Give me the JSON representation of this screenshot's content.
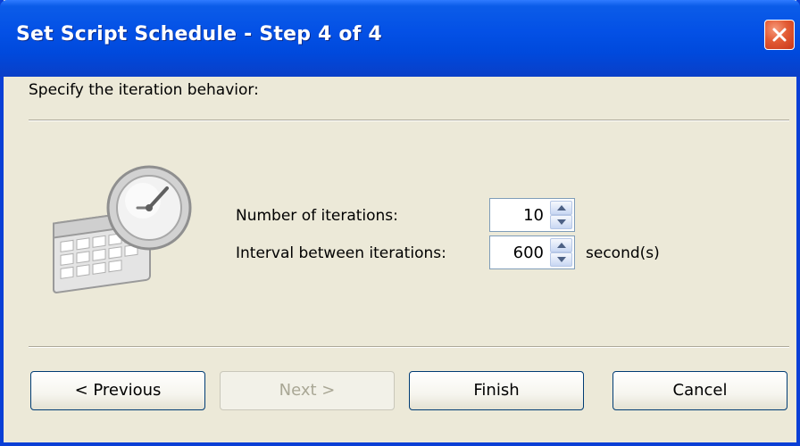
{
  "window": {
    "title": "Set Script Schedule - Step 4 of 4"
  },
  "prompt": "Specify the iteration behavior:",
  "fields": {
    "iterations": {
      "label": "Number of iterations:",
      "value": "10"
    },
    "interval": {
      "label": "Interval between iterations:",
      "value": "600",
      "unit": "second(s)"
    }
  },
  "buttons": {
    "previous": "< Previous",
    "next": "Next >",
    "finish": "Finish",
    "cancel": "Cancel"
  },
  "icons": {
    "close": "close-icon",
    "illustration": "clock-calendar-icon",
    "spin_up": "arrow-up-icon",
    "spin_down": "arrow-down-icon"
  },
  "colors": {
    "title_bar": "#0451e6",
    "close_button": "#e25b34",
    "dialog_bg": "#ece9d8"
  }
}
